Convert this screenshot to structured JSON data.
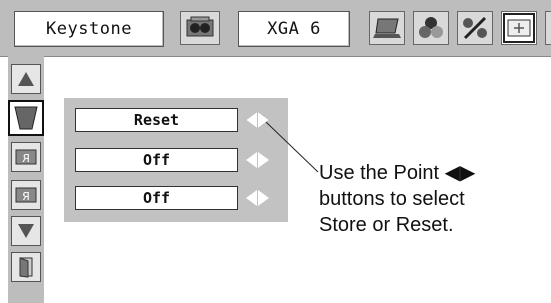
{
  "toolbar": {
    "function_label": "Keystone",
    "input_label": "XGA 6",
    "icons": [
      "projector-settings-icon",
      "laptop-icon",
      "color-balls-icon",
      "percent-stripes-icon",
      "screen-keystone-icon"
    ]
  },
  "sidebar": {
    "items": [
      "up-arrow-icon",
      "keystone-shape-icon",
      "flip-horizontal-icon",
      "flip-vertical-icon",
      "down-arrow-icon",
      "exit-door-icon"
    ]
  },
  "panel": {
    "rows": [
      {
        "value": "Reset"
      },
      {
        "value": "Off"
      },
      {
        "value": "Off"
      }
    ]
  },
  "callout": {
    "line1": "Use the Point ◀▶",
    "line2": "buttons to select",
    "line3": "Store or Reset."
  },
  "colors": {
    "menu_gray": "#bdbdbd",
    "panel_gray": "#c2c2c2",
    "white": "#ffffff",
    "text": "#111111"
  }
}
